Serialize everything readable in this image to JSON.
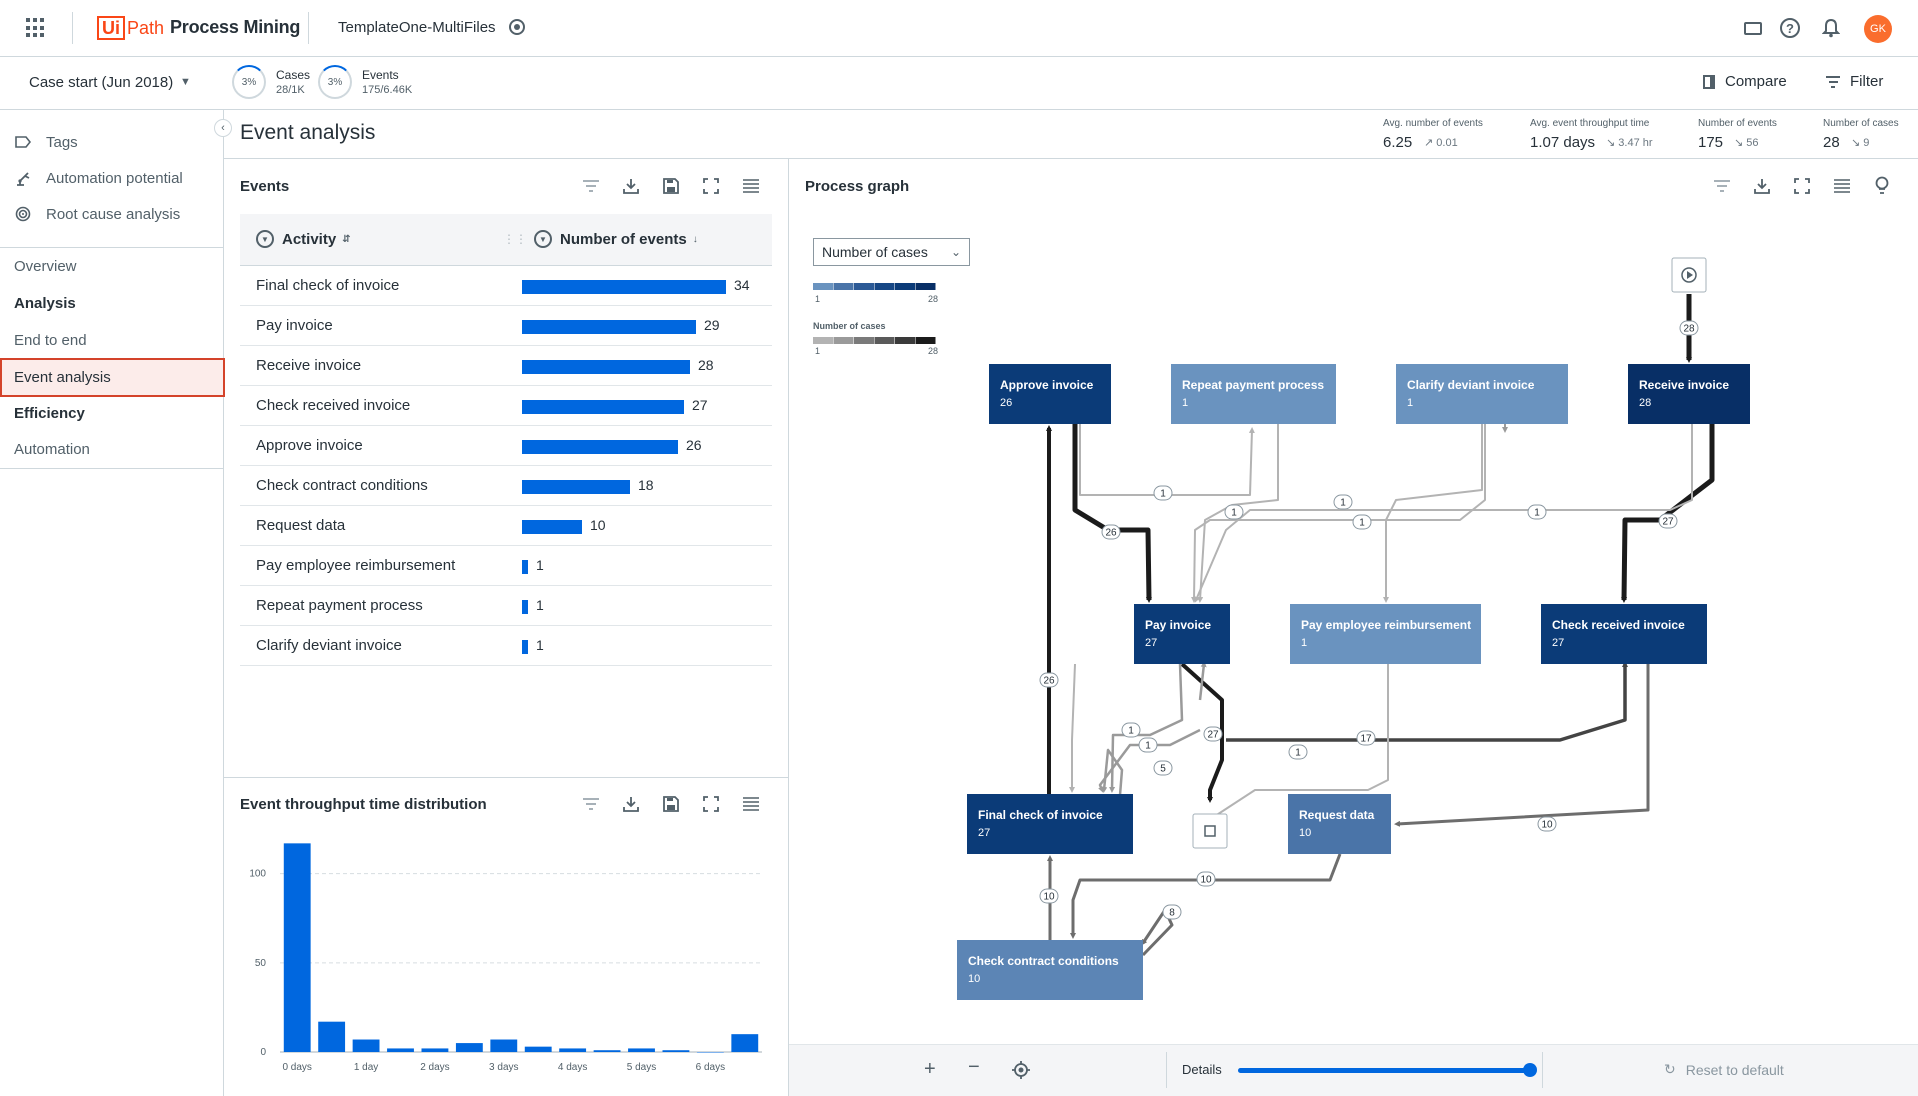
{
  "header": {
    "logo_mark": "Ui",
    "logo_path": "Path",
    "product": "Process Mining",
    "project": "TemplateOne-MultiFiles",
    "avatar_initials": "GK"
  },
  "filter_bar": {
    "case_start": "Case start (Jun 2018)",
    "cases_percent": "3%",
    "cases_label": "Cases",
    "cases_value": "28/1K",
    "events_percent": "3%",
    "events_label": "Events",
    "events_value": "175/6.46K",
    "compare": "Compare",
    "filter": "Filter"
  },
  "sidebar": {
    "tools": [
      {
        "label": "Tags",
        "icon": "tag-icon"
      },
      {
        "label": "Automation potential",
        "icon": "robot-arm-icon"
      },
      {
        "label": "Root cause analysis",
        "icon": "target-icon"
      }
    ],
    "nav": {
      "overview": "Overview",
      "analysis": "Analysis",
      "end_to_end": "End to end",
      "event_analysis": "Event analysis",
      "efficiency": "Efficiency",
      "automation": "Automation"
    }
  },
  "page": {
    "title": "Event analysis",
    "kpis": [
      {
        "label": "Avg. number of events",
        "value": "6.25",
        "delta": "0.01",
        "trend": "up"
      },
      {
        "label": "Avg. event throughput time",
        "value": "1.07 days",
        "delta": "3.47 hr",
        "trend": "down"
      },
      {
        "label": "Number of events",
        "value": "175",
        "delta": "56",
        "trend": "down"
      },
      {
        "label": "Number of cases",
        "value": "28",
        "delta": "9",
        "trend": "down"
      }
    ]
  },
  "events_panel": {
    "title": "Events",
    "columns": [
      "Activity",
      "Number of events"
    ],
    "max_value": 34,
    "rows": [
      {
        "activity": "Final check of invoice",
        "count": 34
      },
      {
        "activity": "Pay invoice",
        "count": 29
      },
      {
        "activity": "Receive invoice",
        "count": 28
      },
      {
        "activity": "Check received invoice",
        "count": 27
      },
      {
        "activity": "Approve invoice",
        "count": 26
      },
      {
        "activity": "Check contract conditions",
        "count": 18
      },
      {
        "activity": "Request data",
        "count": 10
      },
      {
        "activity": "Pay employee reimbursement",
        "count": 1
      },
      {
        "activity": "Repeat payment process",
        "count": 1
      },
      {
        "activity": "Clarify deviant invoice",
        "count": 1
      }
    ]
  },
  "chart_data": {
    "type": "bar",
    "title": "Event throughput time distribution",
    "xlabel": "",
    "ylabel": "",
    "ylim": [
      0,
      120
    ],
    "yticks": [
      0,
      50,
      100
    ],
    "x_tick_labels": [
      "0 days",
      "1 day",
      "2 days",
      "3 days",
      "4 days",
      "5 days",
      "6 days"
    ],
    "values": [
      117,
      17,
      7,
      2,
      2,
      5,
      7,
      3,
      2,
      1,
      2,
      1,
      0,
      10
    ],
    "grid": true
  },
  "process_graph": {
    "title": "Process graph",
    "legend_select": "Number of cases",
    "legend_min": "1",
    "legend_max": "28",
    "legend2_title": "Number of cases",
    "nodes": [
      {
        "name": "Approve invoice",
        "count": "26",
        "color": "#0b3b78"
      },
      {
        "name": "Repeat payment process",
        "count": "1",
        "color": "#6a93bf"
      },
      {
        "name": "Clarify deviant invoice",
        "count": "1",
        "color": "#6a93bf"
      },
      {
        "name": "Receive invoice",
        "count": "28",
        "color": "#082f66"
      },
      {
        "name": "Pay invoice",
        "count": "27",
        "color": "#0b3b78"
      },
      {
        "name": "Pay employee reimbursement",
        "count": "1",
        "color": "#6a93bf"
      },
      {
        "name": "Check received invoice",
        "count": "27",
        "color": "#0b3b78"
      },
      {
        "name": "Final check of invoice",
        "count": "27",
        "color": "#0b3b78"
      },
      {
        "name": "Request data",
        "count": "10",
        "color": "#4a74a8"
      },
      {
        "name": "Check contract conditions",
        "count": "10",
        "color": "#5c85b5"
      }
    ],
    "edge_labels": [
      "28",
      "27",
      "26",
      "26",
      "1",
      "1",
      "1",
      "1",
      "1",
      "27",
      "17",
      "1",
      "1",
      "1",
      "5",
      "10",
      "10",
      "10",
      "8"
    ],
    "details_label": "Details",
    "details_level": 1.0,
    "reset": "Reset to default"
  },
  "colors": {
    "accent": "#0067df",
    "brand": "#fa4616",
    "selected_border": "#d4432a",
    "selected_bg": "#fcecea"
  }
}
